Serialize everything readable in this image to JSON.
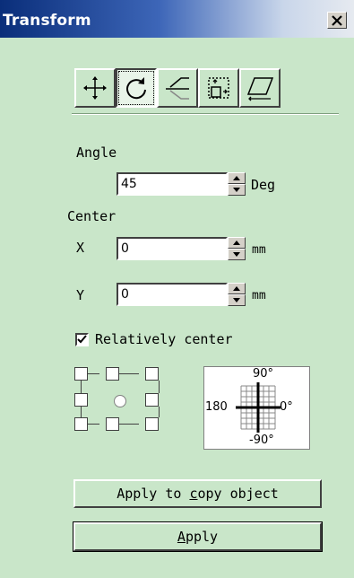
{
  "window": {
    "title": "Transform",
    "close_glyph": "✕"
  },
  "toolbar": {
    "buttons": [
      {
        "name": "move-icon",
        "active": false
      },
      {
        "name": "rotate-icon",
        "active": true
      },
      {
        "name": "mirror-icon",
        "active": false
      },
      {
        "name": "scale-icon",
        "active": false
      },
      {
        "name": "skew-icon",
        "active": false
      }
    ]
  },
  "angle": {
    "label": "Angle",
    "value": "45",
    "unit": "Deg"
  },
  "center": {
    "label": "Center",
    "x_label": "X",
    "x_value": "0",
    "x_unit": "mm",
    "y_label": "Y",
    "y_value": "0",
    "y_unit": "mm"
  },
  "relative": {
    "label": "Relatively center",
    "checked": true
  },
  "dial": {
    "top": "90°",
    "left": "180",
    "right": "0°",
    "bottom": "-90°"
  },
  "buttons": {
    "apply_copy_pre": "Apply to ",
    "apply_copy_u": "c",
    "apply_copy_post": "opy object",
    "apply_u": "A",
    "apply_post": "pply"
  }
}
